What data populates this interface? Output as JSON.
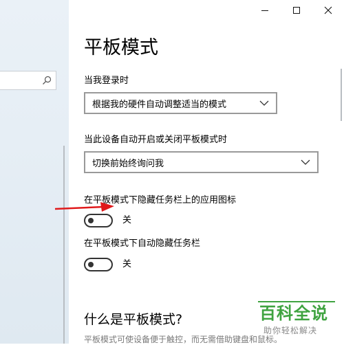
{
  "window": {
    "title": "平板模式",
    "controls": [
      "minimize",
      "maximize",
      "close"
    ]
  },
  "search": {
    "icon": "search-icon"
  },
  "settings": {
    "login_label": "当我登录时",
    "login_value": "根据我的硬件自动调整适当的模式",
    "auto_switch_label": "当此设备自动开启或关闭平板模式时",
    "auto_switch_value": "切换前始终询问我",
    "hide_icons_label": "在平板模式下隐藏任务栏上的应用图标",
    "hide_icons_state": "关",
    "auto_hide_taskbar_label": "在平板模式下自动隐藏任务栏",
    "auto_hide_taskbar_state": "关"
  },
  "about": {
    "title": "什么是平板模式?",
    "description": "平板模式可使设备便于触控，而无需借助键盘和鼠标。"
  },
  "watermark": {
    "brand": "百科全说",
    "tagline": "助你轻松解决"
  },
  "colors": {
    "accent_green": "#3fa340",
    "arrow_red": "#e0191b"
  }
}
